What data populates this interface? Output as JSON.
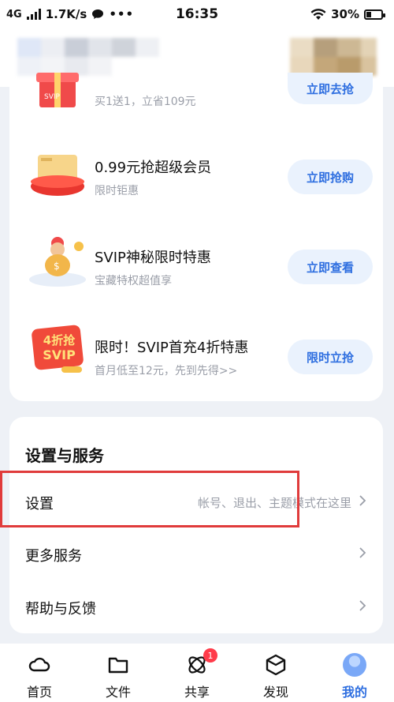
{
  "status_bar": {
    "network": "4G",
    "speed": "1.7K/s",
    "time": "16:35",
    "battery": "30%"
  },
  "promos": [
    {
      "title": "",
      "subtitle": "买1送1，立省109元",
      "button": "立即去抢",
      "icon": "gift-box-icon"
    },
    {
      "title": "0.99元抢超级会员",
      "subtitle": "限时钜惠",
      "button": "立即抢购",
      "icon": "vip-card-icon"
    },
    {
      "title": "SVIP神秘限时特惠",
      "subtitle": "宝藏特权超值享",
      "button": "立即查看",
      "icon": "mascot-coin-icon"
    },
    {
      "title": "限时！SVIP首充4折特惠",
      "subtitle": "首月低至12元，先到先得>>",
      "button": "限时立抢",
      "icon": "svip-discount-badge-icon",
      "badge_text": "4折抢",
      "badge_sub": "SVIP"
    }
  ],
  "settings": {
    "title": "设置与服务",
    "items": [
      {
        "label": "设置",
        "desc": "帐号、退出、主题模式在这里"
      },
      {
        "label": "更多服务",
        "desc": ""
      },
      {
        "label": "帮助与反馈",
        "desc": ""
      }
    ]
  },
  "nav": {
    "items": [
      {
        "label": "首页",
        "icon": "cloud-icon"
      },
      {
        "label": "文件",
        "icon": "folder-icon"
      },
      {
        "label": "共享",
        "icon": "share-atom-icon",
        "badge": "1"
      },
      {
        "label": "发现",
        "icon": "cube-icon"
      },
      {
        "label": "我的",
        "icon": "avatar-icon",
        "active": true
      }
    ]
  },
  "colors": {
    "accent": "#2f6fe0",
    "button_bg": "#eaf2fd",
    "highlight": "#e03b3b",
    "badge": "#ff3b4a"
  }
}
